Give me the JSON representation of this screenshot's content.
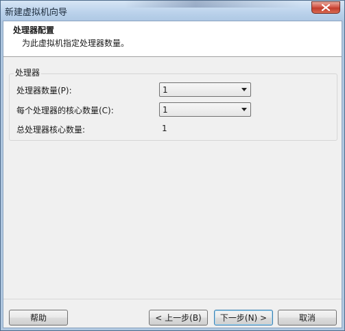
{
  "window": {
    "title": "新建虚拟机向导"
  },
  "header": {
    "title": "处理器配置",
    "subtitle": "为此虚拟机指定处理器数量。"
  },
  "processor_group": {
    "title": "处理器",
    "processor_count": {
      "label": "处理器数量(P):",
      "value": "1"
    },
    "cores_per_processor": {
      "label": "每个处理器的核心数量(C):",
      "value": "1"
    },
    "total_cores": {
      "label": "总处理器核心数量:",
      "value": "1"
    }
  },
  "buttons": {
    "help": "帮助",
    "back": "< 上一步(B)",
    "next": "下一步(N) >",
    "cancel": "取消"
  }
}
